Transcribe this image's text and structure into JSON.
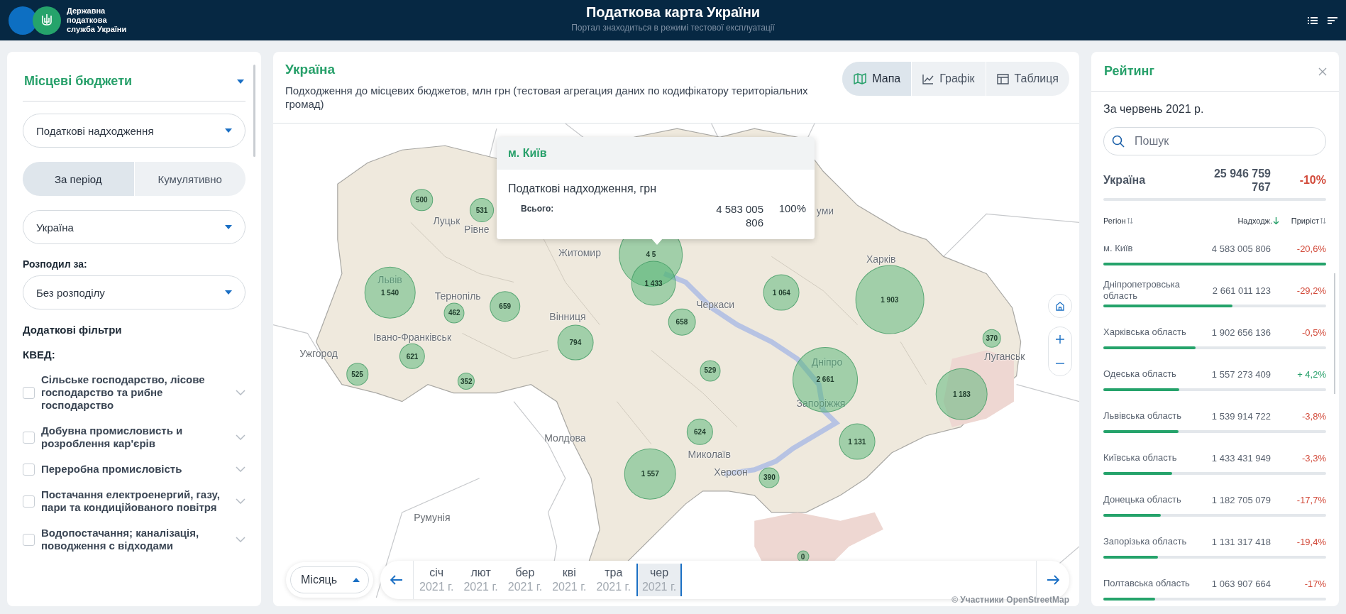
{
  "header": {
    "org_name": "Державна податкова служба України",
    "title": "Податкова карта України",
    "subtitle": "Портал знаходиться в режимі тестової експлуатації"
  },
  "filters": {
    "budget_select": "Місцеві бюджети",
    "indicator_select": "Податкові надходження",
    "period_modes": [
      {
        "label": "За період",
        "selected": true
      },
      {
        "label": "Кумулятивно",
        "selected": false
      }
    ],
    "region_select": "Україна",
    "distribution_label": "Розподил за:",
    "distribution_select": "Без розподілу",
    "extra_filters_title": "Додаткові фільтри",
    "kved_title": "КВЕД:",
    "kved_items": [
      {
        "label": "Сільське господарство, лісове господарство та рибне господарство",
        "checked": false
      },
      {
        "label": "Добувна промисловисть и розроблення кар'єрів",
        "checked": false
      },
      {
        "label": "Переробна промисловість",
        "checked": false
      },
      {
        "label": "Постачання електроенергий, газу, пари та кондиційованого повітря",
        "checked": false
      },
      {
        "label": "Водопостачання; каналізація, поводження с відходами",
        "checked": false
      }
    ]
  },
  "map_panel": {
    "title": "Україна",
    "subtitle": "Подходження до місцевих бюджетов, млн грн (тестовая агрегация даних по кодифікатору територіальних громад)",
    "view_tabs": [
      {
        "label": "Мапа",
        "selected": true
      },
      {
        "label": "Графік",
        "selected": false
      },
      {
        "label": "Таблиця",
        "selected": false
      }
    ],
    "place_labels": [
      {
        "text": "Луцьк"
      },
      {
        "text": "Рівне"
      },
      {
        "text": "Житомир"
      },
      {
        "text": "Львів"
      },
      {
        "text": "Тернопіль"
      },
      {
        "text": "Вінниця"
      },
      {
        "text": "Черкаси"
      },
      {
        "text": "Харків"
      },
      {
        "text": "уми"
      },
      {
        "text": "Івано-Франківськ"
      },
      {
        "text": "Ужгород"
      },
      {
        "text": "Дніпро"
      },
      {
        "text": "Запоріжжя"
      },
      {
        "text": "Луганськ"
      },
      {
        "text": "Молдова"
      },
      {
        "text": "Миколаїв"
      },
      {
        "text": "Херсон"
      },
      {
        "text": "Румунія"
      }
    ],
    "markers": [
      {
        "label": "500"
      },
      {
        "label": "531"
      },
      {
        "label": "4 5"
      },
      {
        "label": "1 540"
      },
      {
        "label": "462"
      },
      {
        "label": "659"
      },
      {
        "label": "1 433"
      },
      {
        "label": "658"
      },
      {
        "label": "1 064"
      },
      {
        "label": "1 903"
      },
      {
        "label": "794"
      },
      {
        "label": "621"
      },
      {
        "label": "525"
      },
      {
        "label": "352"
      },
      {
        "label": "529"
      },
      {
        "label": "2 661"
      },
      {
        "label": "370"
      },
      {
        "label": "1 183"
      },
      {
        "label": "624"
      },
      {
        "label": "1 131"
      },
      {
        "label": "1 557"
      },
      {
        "label": "390"
      },
      {
        "label": "0"
      }
    ],
    "tooltip": {
      "title": "м. Київ",
      "indicator": "Податкові надходження, грн",
      "row_label": "Всього:",
      "row_value": "4 583 005 806",
      "row_share": "100%"
    },
    "granularity_select": "Місяць",
    "months": [
      {
        "month": "січ",
        "year": "2021 г.",
        "selected": false
      },
      {
        "month": "лют",
        "year": "2021 г.",
        "selected": false
      },
      {
        "month": "бер",
        "year": "2021 г.",
        "selected": false
      },
      {
        "month": "кві",
        "year": "2021 г.",
        "selected": false
      },
      {
        "month": "тра",
        "year": "2021 г.",
        "selected": false
      },
      {
        "month": "чер",
        "year": "2021 г.",
        "selected": true
      }
    ],
    "attribution": "© Участники OpenStreetMap"
  },
  "ranking": {
    "title": "Рейтинг",
    "period": "За червень 2021 р.",
    "search": {
      "placeholder": "Пошук"
    },
    "total": {
      "name": "Україна",
      "value": "25 946 759 767",
      "growth": "-10%",
      "positive": false
    },
    "columns": [
      {
        "label": "Регіон"
      },
      {
        "label": "Надходж."
      },
      {
        "label": "Приріст"
      }
    ],
    "rows": [
      {
        "name": "м. Київ",
        "value": "4 583 005 806",
        "growth": "-20,6%",
        "positive": false,
        "level": 1
      },
      {
        "name": "Дніпропетровська область",
        "value": "2 661 011 123",
        "growth": "-29,2%",
        "positive": false,
        "level": 0.58
      },
      {
        "name": "Харківська область",
        "value": "1 902 656 136",
        "growth": "-0,5%",
        "positive": false,
        "level": 0.415
      },
      {
        "name": "Одеська область",
        "value": "1 557 273 409",
        "growth": "+ 4,2%",
        "positive": true,
        "level": 0.34
      },
      {
        "name": "Львівська область",
        "value": "1 539 914 722",
        "growth": "-3,8%",
        "positive": false,
        "level": 0.336
      },
      {
        "name": "Київська область",
        "value": "1 433 431 949",
        "growth": "-3,3%",
        "positive": false,
        "level": 0.31
      },
      {
        "name": "Донецька область",
        "value": "1 182 705 079",
        "growth": "-17,7%",
        "positive": false,
        "level": 0.258
      },
      {
        "name": "Запорізька область",
        "value": "1 131 317 418",
        "growth": "-19,4%",
        "positive": false,
        "level": 0.245
      },
      {
        "name": "Полтавська область",
        "value": "1 063 907 664",
        "growth": "-17%",
        "positive": false,
        "level": 0.232
      }
    ]
  }
}
